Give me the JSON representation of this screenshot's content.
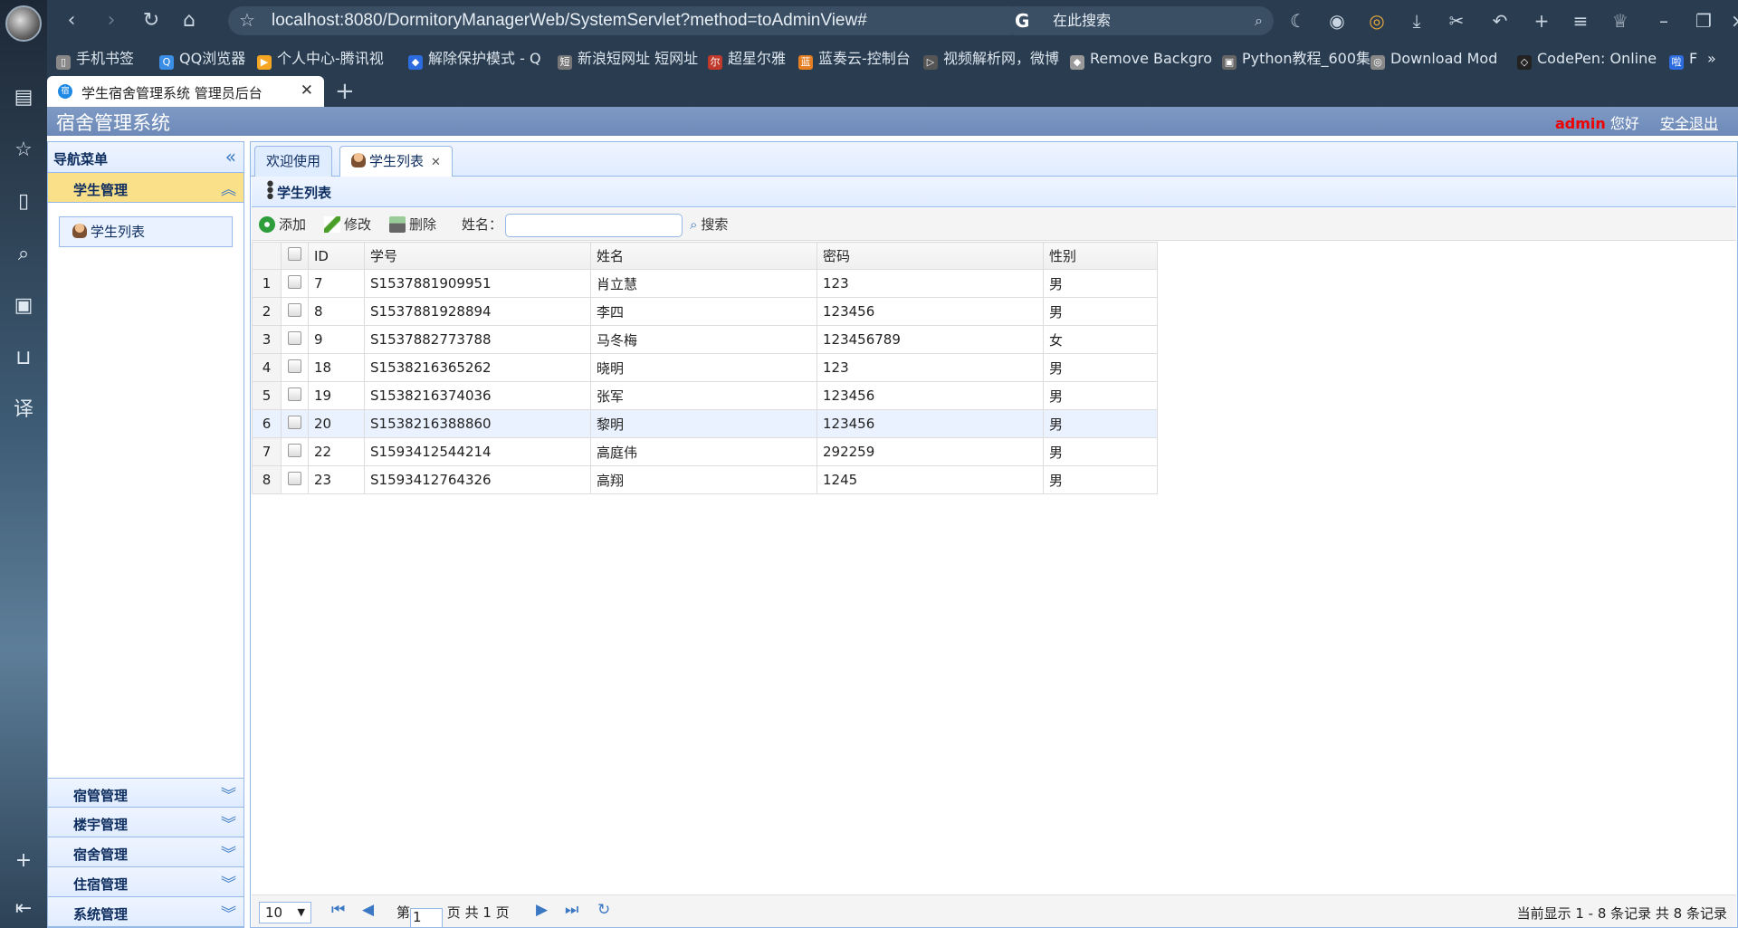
{
  "browser": {
    "url": "localhost:8080/DormitoryManagerWeb/SystemServlet?method=toAdminView#",
    "search_placeholder": "在此搜索",
    "search_engine_icon": "G",
    "tab_title": "学生宿舍管理系统 管理员后台",
    "tab_favicon": "宿",
    "bookmarks": [
      {
        "label": "手机书签",
        "color": "#888"
      },
      {
        "label": "QQ浏览器",
        "color": "#3a8ee6"
      },
      {
        "label": "个人中心-腾讯视",
        "color": "#f5a623"
      },
      {
        "label": "解除保护模式 - Q",
        "color": "#2d6cdf"
      },
      {
        "label": "新浪短网址 短网址",
        "color": "#777"
      },
      {
        "label": "超星尔雅",
        "color": "#c0392b"
      },
      {
        "label": "蓝奏云-控制台",
        "color": "#e67e22"
      },
      {
        "label": "视频解析网，微博",
        "color": "#555"
      },
      {
        "label": "Remove Backgro",
        "color": "#999"
      },
      {
        "label": "Python教程_600集",
        "color": "#666"
      },
      {
        "label": "Download Mod",
        "color": "#888"
      },
      {
        "label": "CodePen: Online",
        "color": "#222"
      },
      {
        "label": "F",
        "color": "#2d6cdf"
      }
    ]
  },
  "app": {
    "title": "宿舍管理系统",
    "user": "admin",
    "greeting": "您好",
    "logout": "安全退出"
  },
  "nav": {
    "header": "导航菜单",
    "sections": [
      {
        "label": "学生管理",
        "open": true
      },
      {
        "label": "宿管管理"
      },
      {
        "label": "楼宇管理"
      },
      {
        "label": "宿舍管理"
      },
      {
        "label": "住宿管理"
      },
      {
        "label": "系统管理"
      }
    ],
    "item": "学生列表"
  },
  "main": {
    "tabs": [
      {
        "label": "欢迎使用"
      },
      {
        "label": "学生列表",
        "active": true
      }
    ],
    "panel_title": "学生列表",
    "toolbar": {
      "add": "添加",
      "edit": "修改",
      "delete": "删除",
      "name_label": "姓名：",
      "name_value": "",
      "search": "搜索"
    },
    "columns": [
      "ID",
      "学号",
      "姓名",
      "密码",
      "性别"
    ],
    "rows": [
      {
        "n": "1",
        "id": "7",
        "sn": "S1537881909951",
        "name": "肖立慧",
        "pwd": "123",
        "sex": "男"
      },
      {
        "n": "2",
        "id": "8",
        "sn": "S1537881928894",
        "name": "李四",
        "pwd": "123456",
        "sex": "男"
      },
      {
        "n": "3",
        "id": "9",
        "sn": "S1537882773788",
        "name": "马冬梅",
        "pwd": "123456789",
        "sex": "女"
      },
      {
        "n": "4",
        "id": "18",
        "sn": "S1538216365262",
        "name": "晓明",
        "pwd": "123",
        "sex": "男"
      },
      {
        "n": "5",
        "id": "19",
        "sn": "S1538216374036",
        "name": "张军",
        "pwd": "123456",
        "sex": "男"
      },
      {
        "n": "6",
        "id": "20",
        "sn": "S1538216388860",
        "name": "黎明",
        "pwd": "123456",
        "sex": "男"
      },
      {
        "n": "7",
        "id": "22",
        "sn": "S1593412544214",
        "name": "高庭伟",
        "pwd": "292259",
        "sex": "男"
      },
      {
        "n": "8",
        "id": "23",
        "sn": "S1593412764326",
        "name": "高翔",
        "pwd": "1245",
        "sex": "男"
      }
    ],
    "pager": {
      "page_size": "10",
      "page_prefix": "第",
      "page": "1",
      "page_suffix": "页 共 1 页",
      "info": "当前显示 1 - 8 条记录 共 8 条记录"
    }
  },
  "colors": {
    "accent": "#95b8e7",
    "header": "#7f9ac4",
    "user": "#e00000",
    "open_section": "#fbe08a"
  }
}
